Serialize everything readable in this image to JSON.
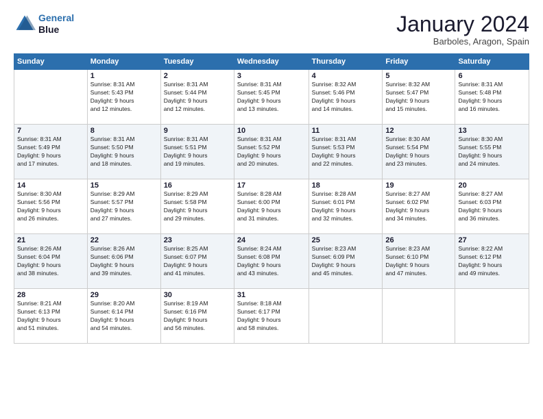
{
  "logo": {
    "line1": "General",
    "line2": "Blue"
  },
  "header": {
    "title": "January 2024",
    "subtitle": "Barboles, Aragon, Spain"
  },
  "days_of_week": [
    "Sunday",
    "Monday",
    "Tuesday",
    "Wednesday",
    "Thursday",
    "Friday",
    "Saturday"
  ],
  "weeks": [
    [
      {
        "day": "",
        "info": ""
      },
      {
        "day": "1",
        "info": "Sunrise: 8:31 AM\nSunset: 5:43 PM\nDaylight: 9 hours\nand 12 minutes."
      },
      {
        "day": "2",
        "info": "Sunrise: 8:31 AM\nSunset: 5:44 PM\nDaylight: 9 hours\nand 12 minutes."
      },
      {
        "day": "3",
        "info": "Sunrise: 8:31 AM\nSunset: 5:45 PM\nDaylight: 9 hours\nand 13 minutes."
      },
      {
        "day": "4",
        "info": "Sunrise: 8:32 AM\nSunset: 5:46 PM\nDaylight: 9 hours\nand 14 minutes."
      },
      {
        "day": "5",
        "info": "Sunrise: 8:32 AM\nSunset: 5:47 PM\nDaylight: 9 hours\nand 15 minutes."
      },
      {
        "day": "6",
        "info": "Sunrise: 8:31 AM\nSunset: 5:48 PM\nDaylight: 9 hours\nand 16 minutes."
      }
    ],
    [
      {
        "day": "7",
        "info": "Sunrise: 8:31 AM\nSunset: 5:49 PM\nDaylight: 9 hours\nand 17 minutes."
      },
      {
        "day": "8",
        "info": "Sunrise: 8:31 AM\nSunset: 5:50 PM\nDaylight: 9 hours\nand 18 minutes."
      },
      {
        "day": "9",
        "info": "Sunrise: 8:31 AM\nSunset: 5:51 PM\nDaylight: 9 hours\nand 19 minutes."
      },
      {
        "day": "10",
        "info": "Sunrise: 8:31 AM\nSunset: 5:52 PM\nDaylight: 9 hours\nand 20 minutes."
      },
      {
        "day": "11",
        "info": "Sunrise: 8:31 AM\nSunset: 5:53 PM\nDaylight: 9 hours\nand 22 minutes."
      },
      {
        "day": "12",
        "info": "Sunrise: 8:30 AM\nSunset: 5:54 PM\nDaylight: 9 hours\nand 23 minutes."
      },
      {
        "day": "13",
        "info": "Sunrise: 8:30 AM\nSunset: 5:55 PM\nDaylight: 9 hours\nand 24 minutes."
      }
    ],
    [
      {
        "day": "14",
        "info": "Sunrise: 8:30 AM\nSunset: 5:56 PM\nDaylight: 9 hours\nand 26 minutes."
      },
      {
        "day": "15",
        "info": "Sunrise: 8:29 AM\nSunset: 5:57 PM\nDaylight: 9 hours\nand 27 minutes."
      },
      {
        "day": "16",
        "info": "Sunrise: 8:29 AM\nSunset: 5:58 PM\nDaylight: 9 hours\nand 29 minutes."
      },
      {
        "day": "17",
        "info": "Sunrise: 8:28 AM\nSunset: 6:00 PM\nDaylight: 9 hours\nand 31 minutes."
      },
      {
        "day": "18",
        "info": "Sunrise: 8:28 AM\nSunset: 6:01 PM\nDaylight: 9 hours\nand 32 minutes."
      },
      {
        "day": "19",
        "info": "Sunrise: 8:27 AM\nSunset: 6:02 PM\nDaylight: 9 hours\nand 34 minutes."
      },
      {
        "day": "20",
        "info": "Sunrise: 8:27 AM\nSunset: 6:03 PM\nDaylight: 9 hours\nand 36 minutes."
      }
    ],
    [
      {
        "day": "21",
        "info": "Sunrise: 8:26 AM\nSunset: 6:04 PM\nDaylight: 9 hours\nand 38 minutes."
      },
      {
        "day": "22",
        "info": "Sunrise: 8:26 AM\nSunset: 6:06 PM\nDaylight: 9 hours\nand 39 minutes."
      },
      {
        "day": "23",
        "info": "Sunrise: 8:25 AM\nSunset: 6:07 PM\nDaylight: 9 hours\nand 41 minutes."
      },
      {
        "day": "24",
        "info": "Sunrise: 8:24 AM\nSunset: 6:08 PM\nDaylight: 9 hours\nand 43 minutes."
      },
      {
        "day": "25",
        "info": "Sunrise: 8:23 AM\nSunset: 6:09 PM\nDaylight: 9 hours\nand 45 minutes."
      },
      {
        "day": "26",
        "info": "Sunrise: 8:23 AM\nSunset: 6:10 PM\nDaylight: 9 hours\nand 47 minutes."
      },
      {
        "day": "27",
        "info": "Sunrise: 8:22 AM\nSunset: 6:12 PM\nDaylight: 9 hours\nand 49 minutes."
      }
    ],
    [
      {
        "day": "28",
        "info": "Sunrise: 8:21 AM\nSunset: 6:13 PM\nDaylight: 9 hours\nand 51 minutes."
      },
      {
        "day": "29",
        "info": "Sunrise: 8:20 AM\nSunset: 6:14 PM\nDaylight: 9 hours\nand 54 minutes."
      },
      {
        "day": "30",
        "info": "Sunrise: 8:19 AM\nSunset: 6:16 PM\nDaylight: 9 hours\nand 56 minutes."
      },
      {
        "day": "31",
        "info": "Sunrise: 8:18 AM\nSunset: 6:17 PM\nDaylight: 9 hours\nand 58 minutes."
      },
      {
        "day": "",
        "info": ""
      },
      {
        "day": "",
        "info": ""
      },
      {
        "day": "",
        "info": ""
      }
    ]
  ]
}
